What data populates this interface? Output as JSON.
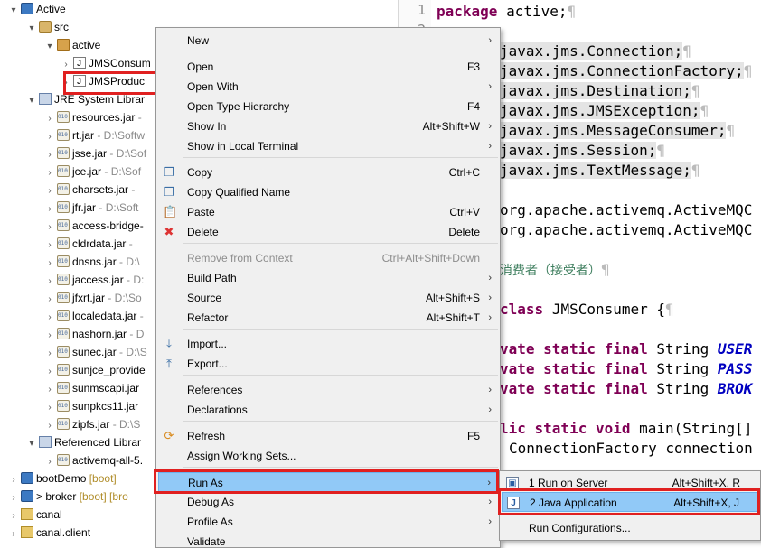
{
  "explorer": {
    "project": "Active",
    "src": "src",
    "package": "active",
    "files": [
      "JMSConsumer.java",
      "JMSProducer.java"
    ],
    "file_visible": [
      "JMSConsum",
      "JMSProduc"
    ],
    "jre": "JRE System Library",
    "jre_visible": "JRE System Librar",
    "jars": [
      {
        "name": "resources.jar",
        "path": "-"
      },
      {
        "name": "rt.jar",
        "path": "- D:\\Softw"
      },
      {
        "name": "jsse.jar",
        "path": "- D:\\Sof"
      },
      {
        "name": "jce.jar",
        "path": "- D:\\Sof"
      },
      {
        "name": "charsets.jar",
        "path": "-"
      },
      {
        "name": "jfr.jar",
        "path": "- D:\\Soft"
      },
      {
        "name": "access-bridge-",
        "path": ""
      },
      {
        "name": "cldrdata.jar",
        "path": "-"
      },
      {
        "name": "dnsns.jar",
        "path": "- D:\\"
      },
      {
        "name": "jaccess.jar",
        "path": "- D:"
      },
      {
        "name": "jfxrt.jar",
        "path": "- D:\\So"
      },
      {
        "name": "localedata.jar",
        "path": "-"
      },
      {
        "name": "nashorn.jar",
        "path": "- D"
      },
      {
        "name": "sunec.jar",
        "path": "- D:\\S"
      },
      {
        "name": "sunjce_provide",
        "path": ""
      },
      {
        "name": "sunmscapi.jar",
        "path": ""
      },
      {
        "name": "sunpkcs11.jar",
        "path": ""
      },
      {
        "name": "zipfs.jar",
        "path": "- D:\\S"
      }
    ],
    "ref_libs": "Referenced Librar",
    "ref_jar": "activemq-all-5.",
    "other_projects": [
      {
        "name": "bootDemo",
        "tag": "[boot]"
      },
      {
        "name": "broker",
        "tag": "[boot] [bro"
      },
      {
        "name": "canal",
        "tag": ""
      },
      {
        "name": "canal.client",
        "tag": ""
      }
    ]
  },
  "editor": {
    "line_numbers": [
      "1",
      "2"
    ],
    "package_kw": "package",
    "package_name": "active;",
    "imports": [
      "javax.jms.Connection;",
      "javax.jms.ConnectionFactory;",
      "javax.jms.Destination;",
      "javax.jms.JMSException;",
      "javax.jms.MessageConsumer;",
      "javax.jms.Session;",
      "javax.jms.TextMessage;"
    ],
    "org_imports": [
      "org.apache.activemq.ActiveMQC",
      "org.apache.activemq.ActiveMQC"
    ],
    "comment": "消费者（接受者）",
    "class_kw": "class",
    "class_rest": "JMSConsumer {",
    "fields": [
      {
        "mods": "vate static final",
        "type": "String",
        "name": "USER"
      },
      {
        "mods": "vate static final",
        "type": "String",
        "name": "PASS"
      },
      {
        "mods": "vate static final",
        "type": "String",
        "name": "BROK"
      }
    ],
    "main_kw": "lic static void",
    "main_rest": "main(String[]",
    "cf_line": "ConnectionFactory connection",
    "pilcrow": "¶"
  },
  "context_menu": {
    "items": [
      {
        "label": "New",
        "shortcut": "",
        "submenu": true
      },
      {
        "label": "Open",
        "shortcut": "F3"
      },
      {
        "label": "Open With",
        "shortcut": "",
        "submenu": true
      },
      {
        "label": "Open Type Hierarchy",
        "shortcut": "F4"
      },
      {
        "label": "Show In",
        "shortcut": "Alt+Shift+W",
        "submenu": true
      },
      {
        "label": "Show in Local Terminal",
        "shortcut": "",
        "submenu": true
      },
      {
        "label": "Copy",
        "shortcut": "Ctrl+C",
        "icon": "copy-icon"
      },
      {
        "label": "Copy Qualified Name",
        "shortcut": "",
        "icon": "copy-qualified-icon"
      },
      {
        "label": "Paste",
        "shortcut": "Ctrl+V",
        "icon": "paste-icon"
      },
      {
        "label": "Delete",
        "shortcut": "Delete",
        "icon": "delete-icon"
      },
      {
        "label": "Remove from Context",
        "shortcut": "Ctrl+Alt+Shift+Down",
        "disabled": true
      },
      {
        "label": "Build Path",
        "shortcut": "",
        "submenu": true
      },
      {
        "label": "Source",
        "shortcut": "Alt+Shift+S",
        "submenu": true
      },
      {
        "label": "Refactor",
        "shortcut": "Alt+Shift+T",
        "submenu": true
      },
      {
        "label": "Import...",
        "shortcut": "",
        "icon": "import-icon"
      },
      {
        "label": "Export...",
        "shortcut": "",
        "icon": "export-icon"
      },
      {
        "label": "References",
        "shortcut": "",
        "submenu": true
      },
      {
        "label": "Declarations",
        "shortcut": "",
        "submenu": true
      },
      {
        "label": "Refresh",
        "shortcut": "F5",
        "icon": "refresh-icon"
      },
      {
        "label": "Assign Working Sets...",
        "shortcut": ""
      },
      {
        "label": "Run As",
        "shortcut": "",
        "submenu": true,
        "active": true
      },
      {
        "label": "Debug As",
        "shortcut": "",
        "submenu": true
      },
      {
        "label": "Profile As",
        "shortcut": "",
        "submenu": true
      },
      {
        "label": "Validate",
        "shortcut": ""
      }
    ]
  },
  "run_as_submenu": {
    "items": [
      {
        "label": "1 Run on Server",
        "shortcut": "Alt+Shift+X, R",
        "icon": "server-icon"
      },
      {
        "label": "2 Java Application",
        "shortcut": "Alt+Shift+X, J",
        "icon": "java-app-icon",
        "active": true
      },
      {
        "label": "Run Configurations...",
        "shortcut": ""
      }
    ]
  },
  "colors": {
    "highlight": "#91c9f7",
    "annotation_red": "#e02020",
    "keyword": "#7f0055",
    "constant": "#0000c0"
  }
}
